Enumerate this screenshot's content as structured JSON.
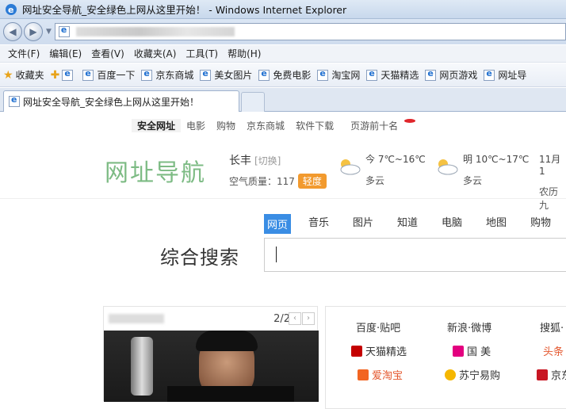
{
  "window": {
    "title": "网址安全导航_安全绿色上网从这里开始！ - Windows Internet Explorer"
  },
  "menu": [
    "文件(F)",
    "编辑(E)",
    "查看(V)",
    "收藏夹(A)",
    "工具(T)",
    "帮助(H)"
  ],
  "favorites": {
    "label": "收藏夹",
    "items": [
      "百度一下",
      "京东商城",
      "美女图片",
      "免费电影",
      "淘宝网",
      "天猫精选",
      "网页游戏",
      "网址导"
    ]
  },
  "tab": {
    "title": "网址安全导航_安全绿色上网从这里开始！"
  },
  "page": {
    "topnav": [
      "安全网址",
      "电影",
      "购物",
      "京东商城",
      "软件下载",
      "页游前十名"
    ],
    "logo": "网址导航",
    "city": "长丰",
    "city_switch": "[切换]",
    "air_label": "空气质量：117",
    "air_badge": "轻度",
    "weather": [
      {
        "day": "今 7℃~16℃",
        "cond": "多云"
      },
      {
        "day": "明 10℃~17℃",
        "cond": "多云"
      },
      {
        "day": "11月1",
        "cond": "农历九"
      }
    ],
    "search_tabs": [
      "网页",
      "音乐",
      "图片",
      "知道",
      "电脑",
      "地图",
      "购物"
    ],
    "search_label": "综合搜索",
    "slideshow_pager": "2/2",
    "sites": [
      "百度·贴吧",
      "新浪·微博",
      "搜狐·",
      "天猫精选",
      "国 美",
      "头条",
      "爱淘宝",
      "苏宁易购",
      "京东"
    ],
    "colors": {
      "logo": "#7dbb84",
      "accent": "#3a8de4",
      "badge": "#f29a2e"
    }
  }
}
